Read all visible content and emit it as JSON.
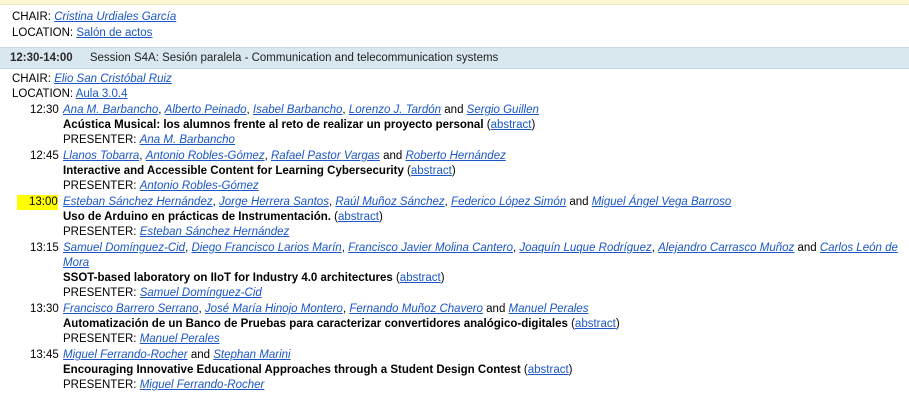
{
  "previous": {
    "chair_label": "CHAIR:",
    "chair_name": "Cristina Urdiales García",
    "location_label": "LOCATION:",
    "location": "Salón de actos"
  },
  "session": {
    "time": "12:30-14:00",
    "title": "Session S4A: Sesión paralela - Communication and telecommunication systems",
    "chair_label": "CHAIR:",
    "chair_name": "Elio San Cristóbal Ruiz",
    "location_label": "LOCATION:",
    "location": "Aula 3.0.4"
  },
  "labels": {
    "and": "and",
    "abstract": "abstract",
    "open_paren": "(",
    "close_paren": ")",
    "presenter": "PRESENTER:"
  },
  "talks": [
    {
      "time": "12:30",
      "authors": [
        "Ana M. Barbancho",
        "Alberto Peinado",
        "Isabel Barbancho",
        "Lorenzo J. Tardón",
        "Sergio Guillen"
      ],
      "title": "Acústica Musical: los alumnos frente al reto de realizar un proyecto personal",
      "presenter": "Ana M. Barbancho"
    },
    {
      "time": "12:45",
      "authors": [
        "Llanos Tobarra",
        "Antonio Robles-Gómez",
        "Rafael Pastor Vargas",
        "Roberto Hernández"
      ],
      "title": "Interactive and Accessible Content for Learning Cybersecurity",
      "presenter": "Antonio Robles-Gómez"
    },
    {
      "time": "13:00",
      "authors": [
        "Esteban Sánchez Hernández",
        "Jorge Herrera Santos",
        "Raúl Muñoz Sánchez",
        "Federico López Simón",
        "Miguel Ángel Vega Barroso"
      ],
      "title": "Uso de Arduino en prácticas de Instrumentación.",
      "presenter": "Esteban Sánchez Hernández"
    },
    {
      "time": "13:15",
      "authors": [
        "Samuel Domínguez-Cid",
        "Diego Francisco Larios Marín",
        "Francisco Javier Molina Cantero",
        "Joaquín Luque Rodríguez",
        "Alejandro Carrasco Muñoz",
        "Carlos León de Mora"
      ],
      "title": "SSOT-based laboratory on IIoT for Industry 4.0 architectures",
      "presenter": "Samuel Domínguez-Cid"
    },
    {
      "time": "13:30",
      "authors": [
        "Francisco Barrero Serrano",
        "José María Hinojo Montero",
        "Fernando Muñoz Chavero",
        "Manuel Perales"
      ],
      "title": "Automatización de un Banco de Pruebas para caracterizar convertidores analógico-digitales",
      "presenter": "Manuel Perales"
    },
    {
      "time": "13:45",
      "authors": [
        "Miguel Ferrando-Rocher",
        "Stephan Marini"
      ],
      "title": "Encouraging Innovative Educational Approaches through a Student Design Contest",
      "presenter": "Miguel Ferrando-Rocher"
    }
  ],
  "highlight_color": "#ffff00"
}
